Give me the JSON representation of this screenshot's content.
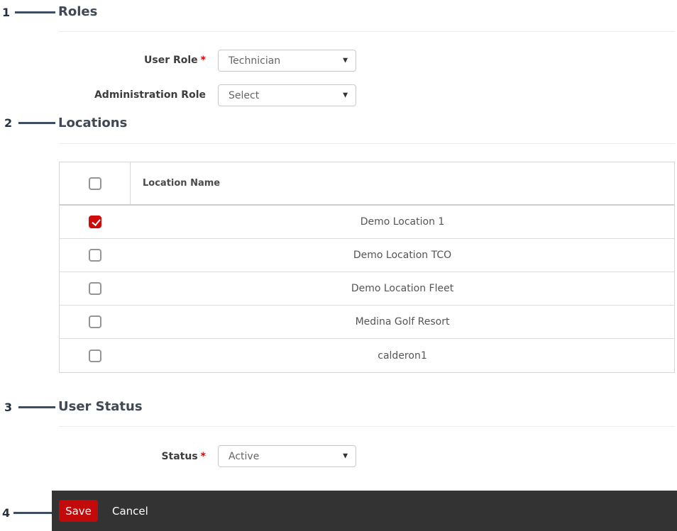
{
  "sections": {
    "roles": {
      "number": "1",
      "title": "Roles"
    },
    "locations": {
      "number": "2",
      "title": "Locations"
    },
    "user_status": {
      "number": "3",
      "title": "User Status"
    },
    "actions": {
      "number": "4"
    }
  },
  "form": {
    "user_role": {
      "label": "User Role",
      "required_marker": "*",
      "value": "Technician"
    },
    "administration_role": {
      "label": "Administration Role",
      "value": "Select"
    },
    "status": {
      "label": "Status",
      "required_marker": "*",
      "value": "Active"
    }
  },
  "locations_table": {
    "column_header": "Location Name",
    "select_all_checked": false,
    "rows": [
      {
        "name": "Demo Location 1",
        "checked": true
      },
      {
        "name": "Demo Location TCO",
        "checked": false
      },
      {
        "name": "Demo Location Fleet",
        "checked": false
      },
      {
        "name": "Medina Golf Resort",
        "checked": false
      },
      {
        "name": "calderon1",
        "checked": false
      }
    ]
  },
  "footer": {
    "save_label": "Save",
    "cancel_label": "Cancel"
  },
  "icons": {
    "dropdown_caret": "▼"
  },
  "colors": {
    "accent_red": "#c20a0a",
    "checkbox_checked": "#cf0b0b",
    "footer_bg": "#333333",
    "annotation": "#3e4e62"
  }
}
